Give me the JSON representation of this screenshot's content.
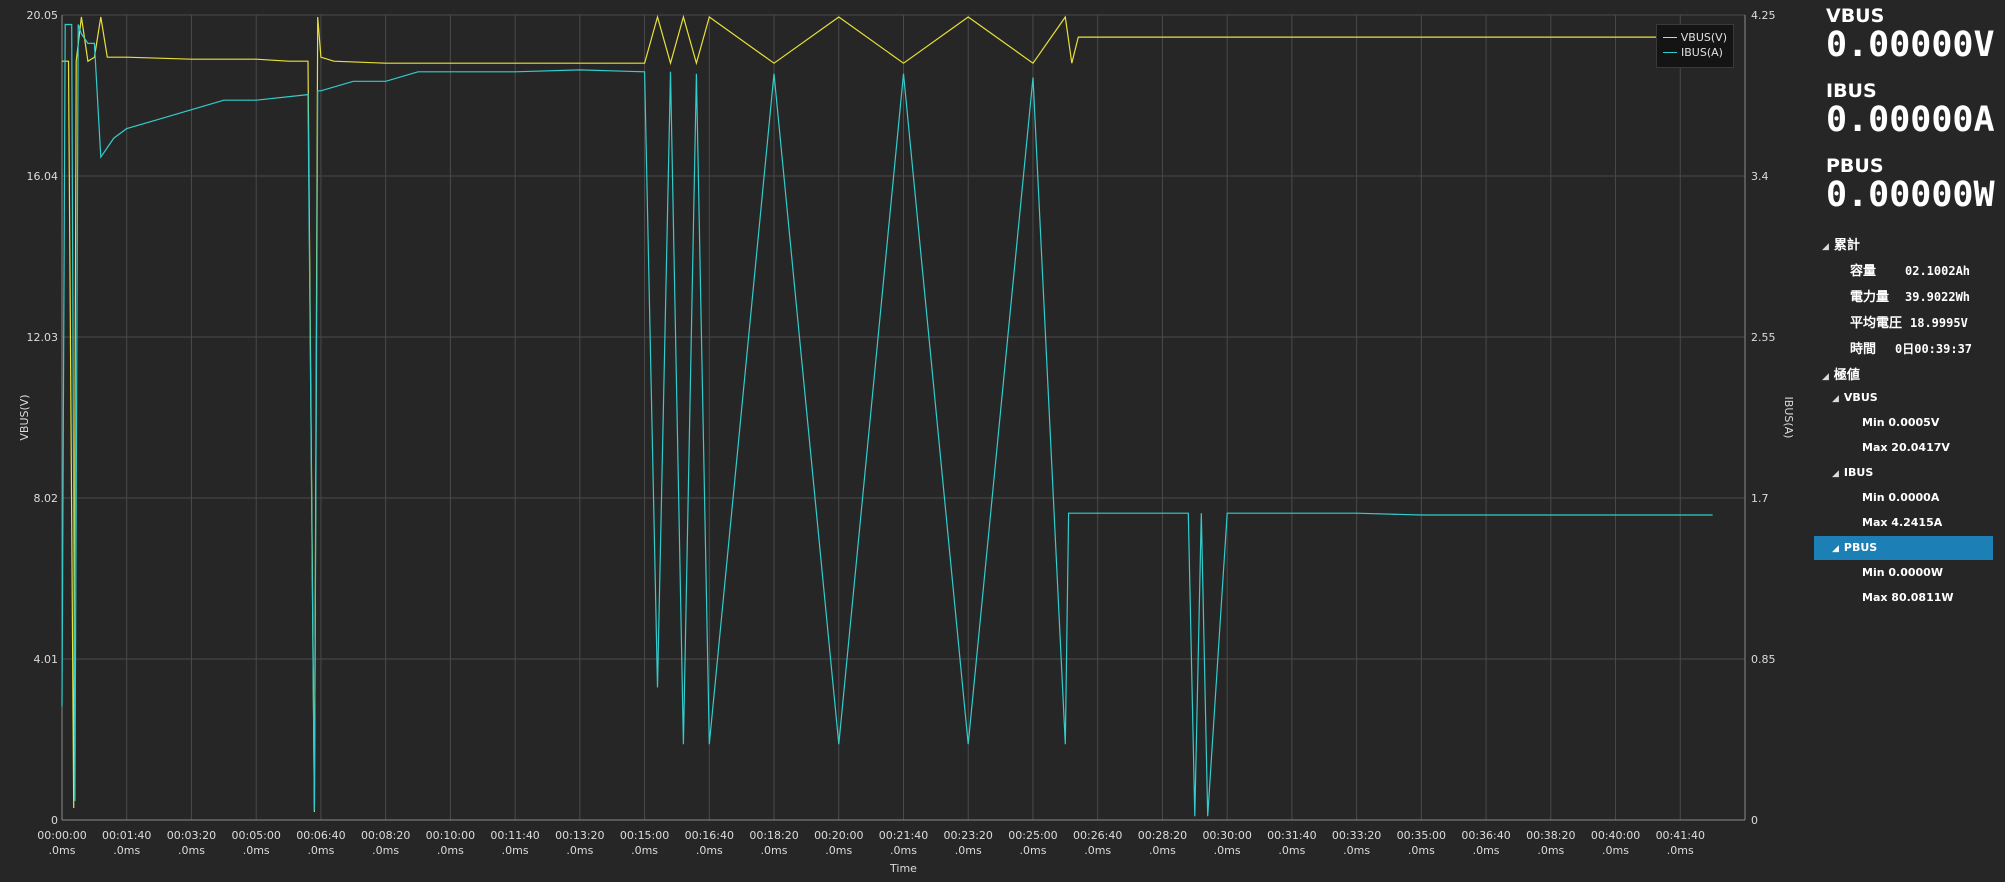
{
  "chart_data": {
    "type": "line",
    "title": "",
    "xlabel": "Time",
    "ylabel_left": "VBUS(V)",
    "ylabel_right": "IBUS(A)",
    "x_tick_labels": [
      "00:00:00",
      "00:01:40",
      "00:03:20",
      "00:05:00",
      "00:06:40",
      "00:08:20",
      "00:10:00",
      "00:11:40",
      "00:13:20",
      "00:15:00",
      "00:16:40",
      "00:18:20",
      "00:20:00",
      "00:21:40",
      "00:23:20",
      "00:25:00",
      "00:26:40",
      "00:28:20",
      "00:30:00",
      "00:31:40",
      "00:33:20",
      "00:35:00",
      "00:36:40",
      "00:38:20",
      "00:40:00",
      "00:41:40"
    ],
    "x_tick_suffix": ".0ms",
    "x_range_seconds": [
      0,
      2600
    ],
    "y_left_ticks": [
      "0",
      "4.01",
      "8.02",
      "12.03",
      "16.04",
      "20.05"
    ],
    "y_left_range": [
      0,
      20.05
    ],
    "y_right_ticks": [
      "0",
      "0.85",
      "1.7",
      "2.55",
      "3.4",
      "4.25"
    ],
    "y_right_range": [
      0,
      4.25
    ],
    "grid": true,
    "legend_position": "top-right",
    "series": [
      {
        "name": "VBUS(V)",
        "axis": "left",
        "color": "#e8e03a",
        "x": [
          0,
          10,
          18,
          22,
          30,
          40,
          50,
          60,
          70,
          80,
          100,
          200,
          300,
          350,
          380,
          390,
          395,
          400,
          420,
          500,
          600,
          700,
          800,
          900,
          920,
          940,
          960,
          980,
          1000,
          1100,
          1200,
          1300,
          1400,
          1500,
          1550,
          1560,
          1570,
          1580,
          1600,
          1650,
          1700,
          1750,
          1800,
          1850,
          1900,
          1950,
          2000,
          2050,
          2100,
          2150,
          2200,
          2300,
          2400,
          2500,
          2550
        ],
        "y": [
          18.9,
          18.9,
          0.3,
          18.9,
          20.0,
          18.9,
          19.0,
          20.0,
          19.0,
          19.0,
          19.0,
          18.95,
          18.95,
          18.9,
          18.9,
          0.2,
          20.0,
          19.0,
          18.9,
          18.85,
          18.85,
          18.85,
          18.85,
          18.85,
          20.0,
          18.85,
          20.0,
          18.85,
          20.0,
          18.85,
          20.0,
          18.85,
          20.0,
          18.85,
          20.0,
          18.85,
          19.5,
          19.5,
          19.5,
          19.5,
          19.5,
          19.5,
          19.5,
          19.5,
          19.5,
          19.5,
          19.5,
          19.5,
          19.5,
          19.5,
          19.5,
          19.5,
          19.5,
          19.5,
          19.5
        ]
      },
      {
        "name": "IBUS(A)",
        "axis": "right",
        "color": "#33cccc",
        "x": [
          0,
          5,
          15,
          20,
          25,
          30,
          40,
          50,
          60,
          70,
          80,
          100,
          150,
          200,
          250,
          300,
          380,
          390,
          395,
          400,
          450,
          500,
          550,
          600,
          650,
          700,
          800,
          900,
          920,
          940,
          960,
          980,
          1000,
          1100,
          1200,
          1300,
          1400,
          1500,
          1550,
          1555,
          1570,
          1600,
          1650,
          1700,
          1740,
          1750,
          1760,
          1770,
          1800,
          1900,
          2000,
          2100,
          2200,
          2300,
          2400,
          2500,
          2550
        ],
        "y": [
          0.6,
          4.2,
          4.2,
          0.1,
          4.2,
          4.15,
          4.1,
          4.1,
          3.5,
          3.55,
          3.6,
          3.65,
          3.7,
          3.75,
          3.8,
          3.8,
          3.83,
          0.05,
          3.85,
          3.85,
          3.9,
          3.9,
          3.95,
          3.95,
          3.95,
          3.95,
          3.96,
          3.95,
          0.7,
          3.95,
          0.4,
          3.94,
          0.4,
          3.94,
          0.4,
          3.94,
          0.4,
          3.92,
          0.4,
          1.62,
          1.62,
          1.62,
          1.62,
          1.62,
          1.62,
          0.02,
          1.62,
          0.02,
          1.62,
          1.62,
          1.62,
          1.61,
          1.61,
          1.61,
          1.61,
          1.61,
          1.61
        ]
      }
    ]
  },
  "panel": {
    "vbus": {
      "label": "VBUS",
      "value": "0.00000V"
    },
    "ibus": {
      "label": "IBUS",
      "value": "0.00000A"
    },
    "pbus": {
      "label": "PBUS",
      "value": "0.00000W"
    },
    "cumulative": {
      "header": "累計",
      "capacity_label": "容量",
      "capacity_value": "02.1002Ah",
      "energy_label": "電力量",
      "energy_value": "39.9022Wh",
      "avg_voltage_label": "平均電圧",
      "avg_voltage_value": "18.9995V",
      "time_label": "時間",
      "time_value": "0日00:39:37"
    },
    "extremes": {
      "header": "極値",
      "vbus": {
        "label": "VBUS",
        "min": "Min 0.0005V",
        "max": "Max 20.0417V"
      },
      "ibus": {
        "label": "IBUS",
        "min": "Min 0.0000A",
        "max": "Max 4.2415A"
      },
      "pbus": {
        "label": "PBUS",
        "min": "Min 0.0000W",
        "max": "Max 80.0811W"
      }
    }
  },
  "colors": {
    "background": "#262626",
    "grid": "#4a4a4a",
    "selection": "#1c7fb5"
  }
}
